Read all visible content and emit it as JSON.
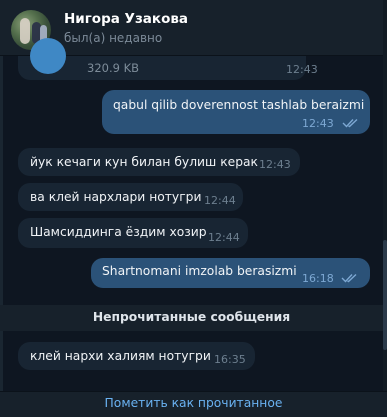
{
  "header": {
    "contact_name": "Нигора Узакова",
    "status": "был(а) недавно"
  },
  "file_message": {
    "size": "320.9 KB",
    "time": "12:43"
  },
  "messages": [
    {
      "direction": "out",
      "text": "qabul qilib doverennost tashlab beraizmi",
      "time": "12:43",
      "read": true
    },
    {
      "direction": "in",
      "text": "йук кечаги кун билан булиш керак",
      "time": "12:43"
    },
    {
      "direction": "in",
      "text": "ва клей нархлари нотугри",
      "time": "12:44"
    },
    {
      "direction": "in",
      "text": "Шамсиддинга ёздим хозир",
      "time": "12:44"
    },
    {
      "direction": "out",
      "text": "Shartnomani imzolab berasizmi",
      "time": "16:18",
      "read": true
    },
    {
      "direction": "in",
      "text": "клей нархи халиям нотугри",
      "time": "16:35"
    }
  ],
  "unread_divider": "Непрочитанные сообщения",
  "footer": {
    "mark_read_label": "Пометить как прочитанное"
  },
  "colors": {
    "background": "#0e1621",
    "incoming_bubble": "#182533",
    "outgoing_bubble": "#2b5278",
    "accent": "#6ab2f2"
  }
}
